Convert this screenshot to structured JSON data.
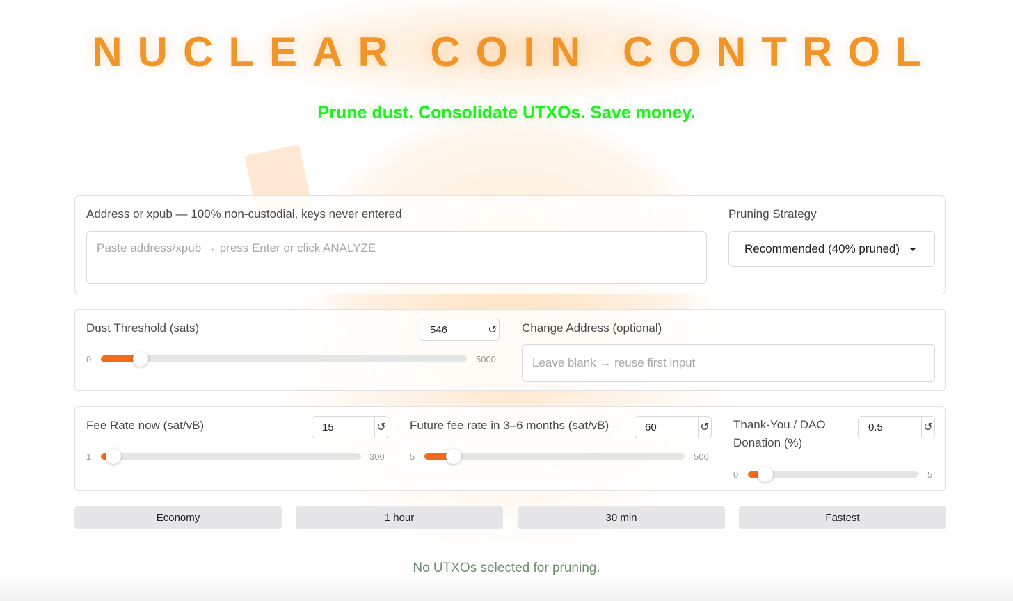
{
  "header": {
    "title": "NUCLEAR COIN CONTROL",
    "subtitle": "Prune dust. Consolidate UTXOs. Save money."
  },
  "address": {
    "label": "Address or xpub — 100% non-custodial, keys never entered",
    "placeholder": "Paste address/xpub → press Enter or click ANALYZE",
    "value": ""
  },
  "strategy": {
    "label": "Pruning Strategy",
    "selected": "Recommended (40% pruned)"
  },
  "dust": {
    "label": "Dust Threshold (sats)",
    "value": "546",
    "min": "0",
    "max": "5000",
    "fraction": 0.109
  },
  "change": {
    "label": "Change Address (optional)",
    "placeholder": "Leave blank → reuse first input"
  },
  "fee_now": {
    "label": "Fee Rate now (sat/vB)",
    "value": "15",
    "min": "1",
    "max": "300",
    "fraction": 0.047
  },
  "fee_future": {
    "label": "Future fee rate in 3–6 months (sat/vB)",
    "value": "60",
    "min": "5",
    "max": "500",
    "fraction": 0.111
  },
  "donation": {
    "label": "Thank-You / DAO Donation (%)",
    "value": "0.5",
    "min": "0",
    "max": "5",
    "fraction": 0.1
  },
  "presets": [
    "Economy",
    "1 hour",
    "30 min",
    "Fastest"
  ],
  "status": "No UTXOs selected for pruning.",
  "icons": {
    "reset": "reset-icon",
    "dropdown": "caret-down-icon"
  },
  "colors": {
    "title": "#f0952a",
    "subtitle": "#22ee22",
    "accent": "#f26b1d",
    "status": "#6a8f6a"
  }
}
